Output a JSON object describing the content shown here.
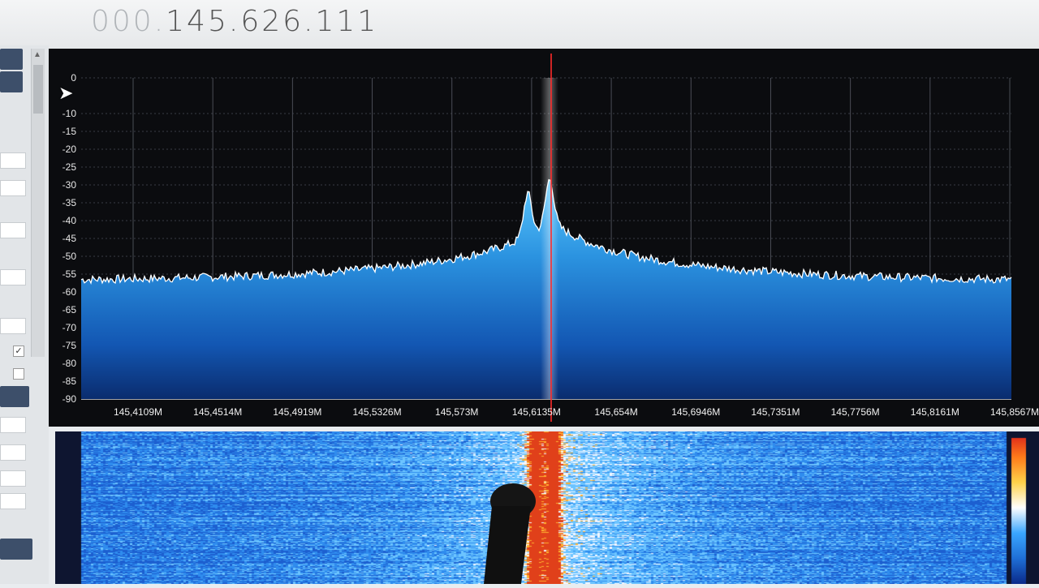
{
  "frequency_display": {
    "leading_digits": "000.",
    "main_digits": "145.626.111"
  },
  "spectrum": {
    "y_axis_labels": [
      "0",
      "-10",
      "-15",
      "-20",
      "-25",
      "-30",
      "-35",
      "-40",
      "-45",
      "-50",
      "-55",
      "-60",
      "-65",
      "-70",
      "-75",
      "-80",
      "-85",
      "-90"
    ],
    "x_axis_labels": [
      "145,4109M",
      "145,4514M",
      "145,4919M",
      "145,5326M",
      "145,573M",
      "145,6135M",
      "145,654M",
      "145,6946M",
      "145,7351M",
      "145,7756M",
      "145,8161M",
      "145,8567M"
    ],
    "noise_floor_db": -57,
    "peak_db": -25,
    "accent_color": "#3fa6e8",
    "marker_color": "#ff2a2a"
  },
  "waterfall": {
    "colormap": [
      "#0a2a8a",
      "#1f6fd6",
      "#3aa6ff",
      "#ffffff",
      "#ffd24a",
      "#ff7a1a",
      "#d81a1a"
    ]
  },
  "sidebar": {
    "checkboxes": [
      {
        "checked": true
      },
      {
        "checked": false
      }
    ]
  }
}
